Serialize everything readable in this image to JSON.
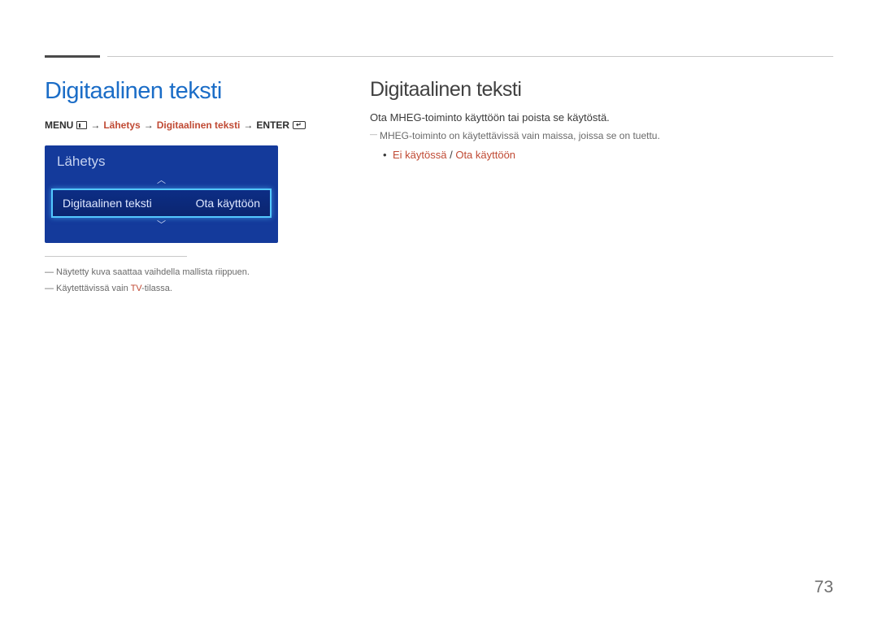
{
  "page_number": "73",
  "left": {
    "title": "Digitaalinen teksti",
    "breadcrumb": {
      "menu_label": "MENU",
      "step1": "Lähetys",
      "step2": "Digitaalinen teksti",
      "enter_label": "ENTER"
    },
    "osd": {
      "header": "Lähetys",
      "row_label": "Digitaalinen teksti",
      "row_value": "Ota käyttöön",
      "arrow_up": "︿",
      "arrow_down": "﹀"
    },
    "footnotes": {
      "fn1_prefix": "―  Näytetty kuva saattaa vaihdella mallista riippuen.",
      "fn2_prefix": "―  Käytettävissä vain ",
      "fn2_accent": "TV",
      "fn2_suffix": "-tilassa."
    }
  },
  "right": {
    "title": "Digitaalinen teksti",
    "desc": "Ota MHEG-toiminto käyttöön tai poista se käytöstä.",
    "sub_note": "MHEG-toiminto on käytettävissä vain maissa, joissa se on tuettu.",
    "bullet": {
      "opt1": "Ei käytössä",
      "sep": " / ",
      "opt2": "Ota käyttöön"
    }
  }
}
